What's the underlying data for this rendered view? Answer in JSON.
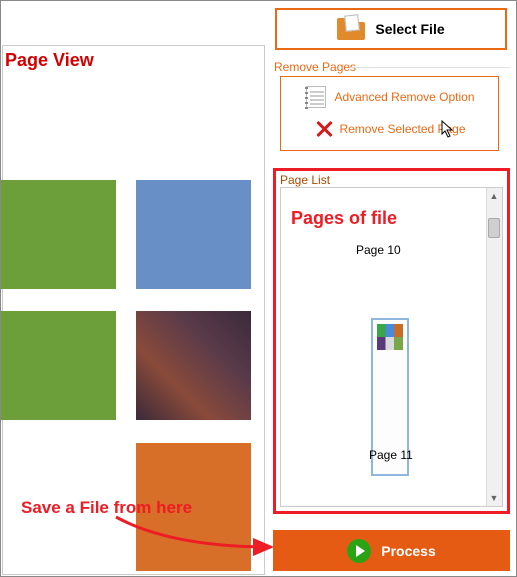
{
  "annotations": {
    "page_view": "Page View",
    "pages_of_file": "Pages of file",
    "save_file": "Save a File from here"
  },
  "buttons": {
    "select_file": "Select File",
    "advanced_remove": "Advanced Remove Option",
    "remove_selected": "Remove Selected Page",
    "process": "Process"
  },
  "labels": {
    "remove_pages": "Remove Pages",
    "page_list": "Page List"
  },
  "page_list": {
    "items": [
      {
        "label": "Page 10"
      },
      {
        "label": "Page 11"
      }
    ]
  },
  "colors": {
    "orange_border": "#e96a13",
    "red_callout": "#ee1c25",
    "process_bg": "#e55b13",
    "play_green": "#2aa415"
  }
}
